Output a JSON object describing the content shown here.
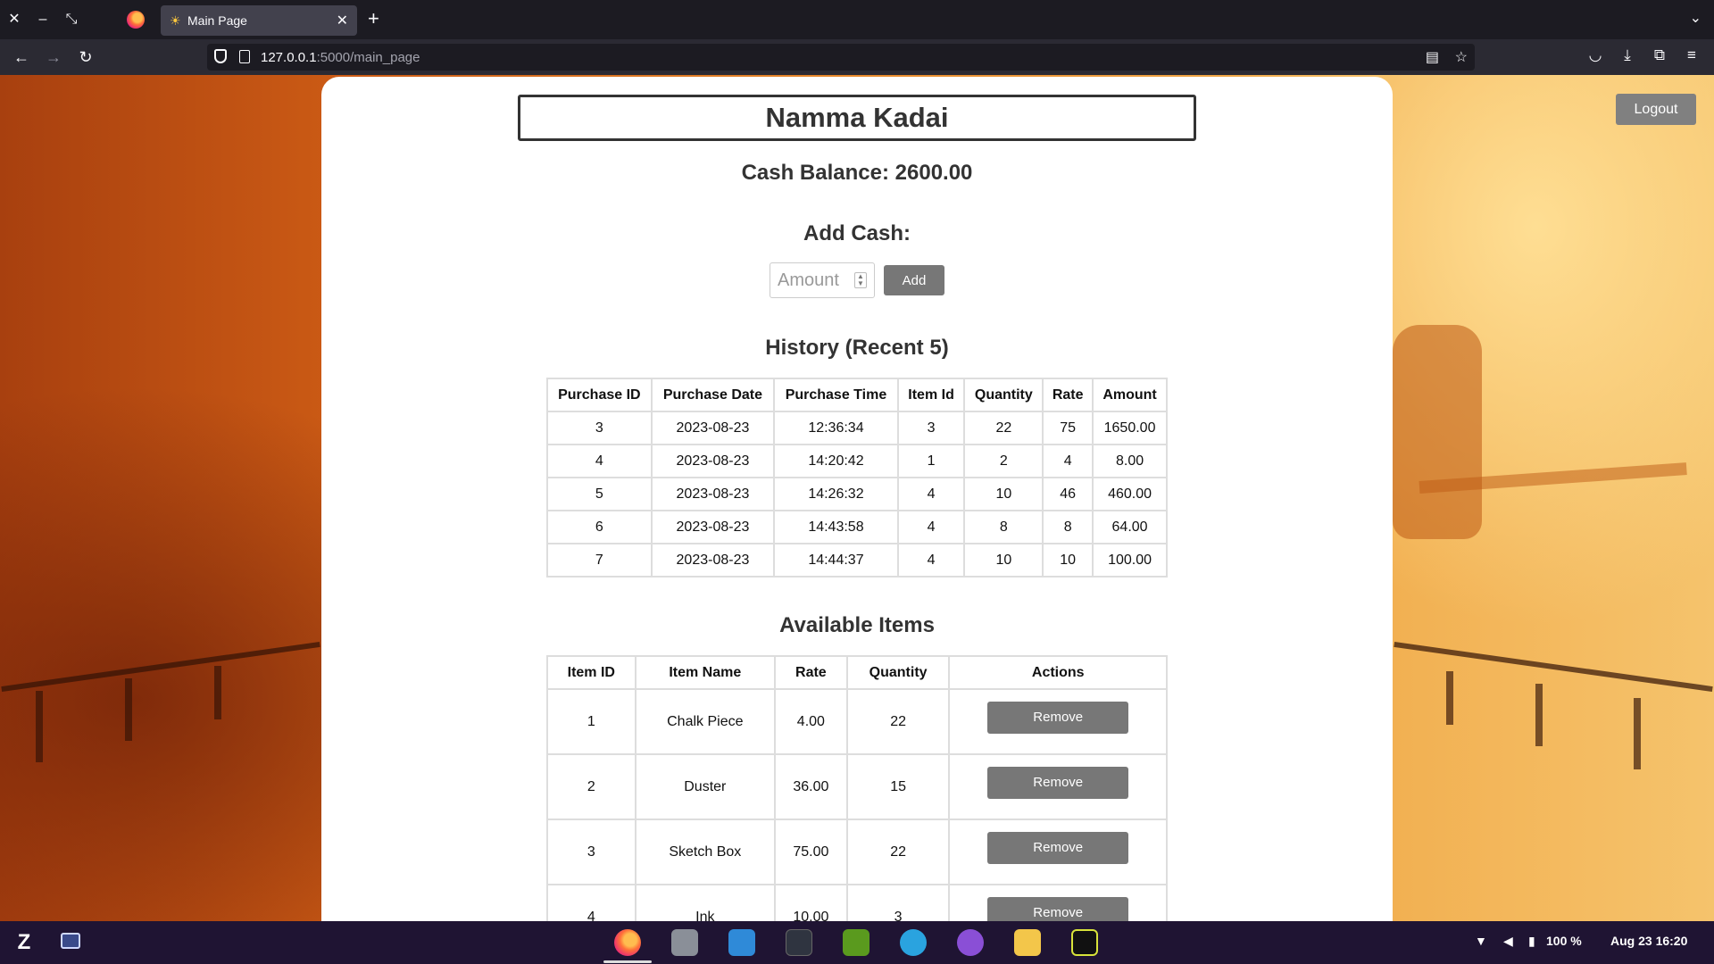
{
  "browser": {
    "tab_title": "Main Page",
    "url_host": "127.0.0.1",
    "url_rest": ":5000/main_page",
    "colors": {
      "tabbar": "#1c1b22",
      "toolbar": "#2b2a33",
      "active_tab": "#42414d"
    }
  },
  "header": {
    "brand": "Namma Kadai",
    "logout_label": "Logout"
  },
  "cash": {
    "balance_text": "Cash Balance: 2600.00",
    "add_heading": "Add Cash:",
    "amount_placeholder": "Amount",
    "add_label": "Add"
  },
  "history": {
    "heading": "History (Recent 5)",
    "columns": [
      "Purchase ID",
      "Purchase Date",
      "Purchase Time",
      "Item Id",
      "Quantity",
      "Rate",
      "Amount"
    ],
    "rows": [
      [
        "3",
        "2023-08-23",
        "12:36:34",
        "3",
        "22",
        "75",
        "1650.00"
      ],
      [
        "4",
        "2023-08-23",
        "14:20:42",
        "1",
        "2",
        "4",
        "8.00"
      ],
      [
        "5",
        "2023-08-23",
        "14:26:32",
        "4",
        "10",
        "46",
        "460.00"
      ],
      [
        "6",
        "2023-08-23",
        "14:43:58",
        "4",
        "8",
        "8",
        "64.00"
      ],
      [
        "7",
        "2023-08-23",
        "14:44:37",
        "4",
        "10",
        "10",
        "100.00"
      ]
    ]
  },
  "items": {
    "heading": "Available Items",
    "columns": [
      "Item ID",
      "Item Name",
      "Rate",
      "Quantity",
      "Actions"
    ],
    "remove_label": "Remove",
    "rows": [
      [
        "1",
        "Chalk Piece",
        "4.00",
        "22"
      ],
      [
        "2",
        "Duster",
        "36.00",
        "15"
      ],
      [
        "3",
        "Sketch Box",
        "75.00",
        "22"
      ],
      [
        "4",
        "Ink",
        "10.00",
        "3"
      ]
    ]
  },
  "taskbar": {
    "battery": "100 %",
    "clock": "Aug 23  16:20",
    "apps": [
      "zorin-menu-icon",
      "workspaces-icon",
      "firefox-icon",
      "files-icon",
      "store-icon",
      "terminal-icon",
      "nvidia-icon",
      "telegram-icon",
      "github-icon",
      "text-editor-icon",
      "pycharm-icon"
    ]
  },
  "colors": {
    "button_gray": "#777777",
    "table_border": "#dddddd",
    "heading_text": "#333333"
  }
}
